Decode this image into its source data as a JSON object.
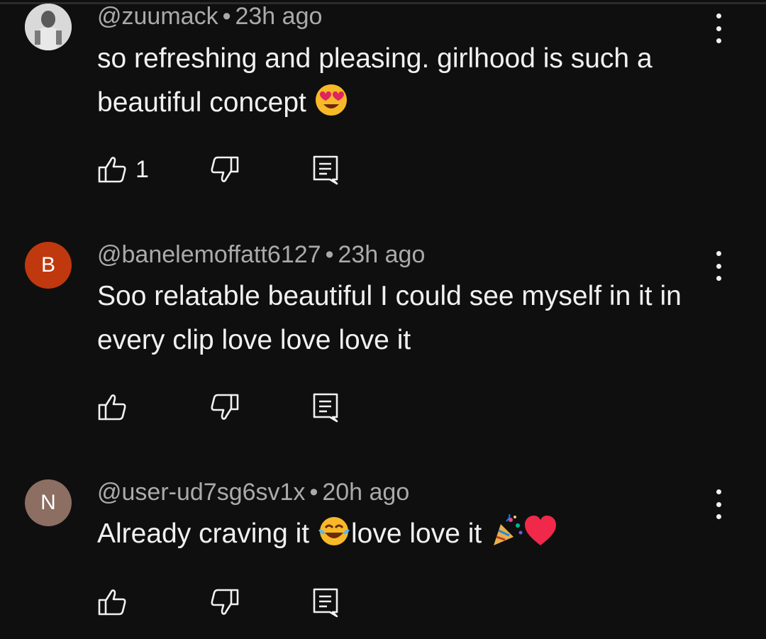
{
  "comments": [
    {
      "avatar_letter": "",
      "avatar_color": "#cfcfcf",
      "handle": "@zuumack",
      "time": "23h ago",
      "text_parts": [
        "so refreshing and pleasing. girlhood is such a beautiful concept "
      ],
      "emoji": [
        "heart-eyes-emoji"
      ],
      "likes": "1"
    },
    {
      "avatar_letter": "B",
      "avatar_color": "#c0380e",
      "handle": "@banelemoffatt6127",
      "time": "23h ago",
      "text_parts": [
        "Soo relatable beautiful I could see myself in it in every clip love love love it"
      ],
      "likes": ""
    },
    {
      "avatar_letter": "N",
      "avatar_color": "#8d6e63",
      "handle": "@user-ud7sg6sv1x",
      "time": "20h ago",
      "text_parts": [
        "Already craving it ",
        "love love it "
      ],
      "emoji": [
        "tears-of-joy-emoji",
        "party-popper-emoji",
        "red-heart-emoji"
      ],
      "likes": ""
    }
  ],
  "separator": "•"
}
